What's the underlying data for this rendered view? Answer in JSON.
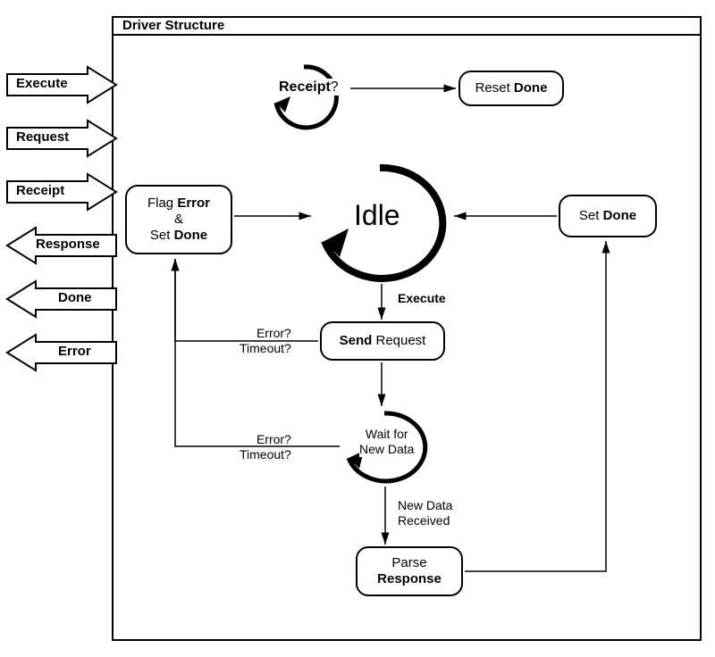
{
  "frame": {
    "title": "Driver Structure"
  },
  "ports": {
    "execute": "Execute",
    "request": "Request",
    "receipt": "Receipt",
    "response": "Response",
    "done": "Done",
    "error": "Error"
  },
  "nodes": {
    "receiptQ": "Receipt",
    "receiptQmark": "?",
    "resetDonePre": "Reset ",
    "resetDoneBold": "Done",
    "flagLine1a": "Flag ",
    "flagLine1b": "Error",
    "flagLine2": "&",
    "flagLine3a": "Set ",
    "flagLine3b": "Done",
    "idle": "Idle",
    "setDonePre": "Set ",
    "setDoneBold": "Done",
    "sendBold": "Send",
    "sendRest": " Request",
    "waitLine1": "Wait for",
    "waitLine2": "New Data",
    "parseLine1": "Parse",
    "parseLine2": "Response"
  },
  "edges": {
    "execute": "Execute",
    "err1a": "Error?",
    "err1b": "Timeout?",
    "err2a": "Error?",
    "err2b": "Timeout?",
    "newData1": "New Data",
    "newData2": "Received"
  }
}
